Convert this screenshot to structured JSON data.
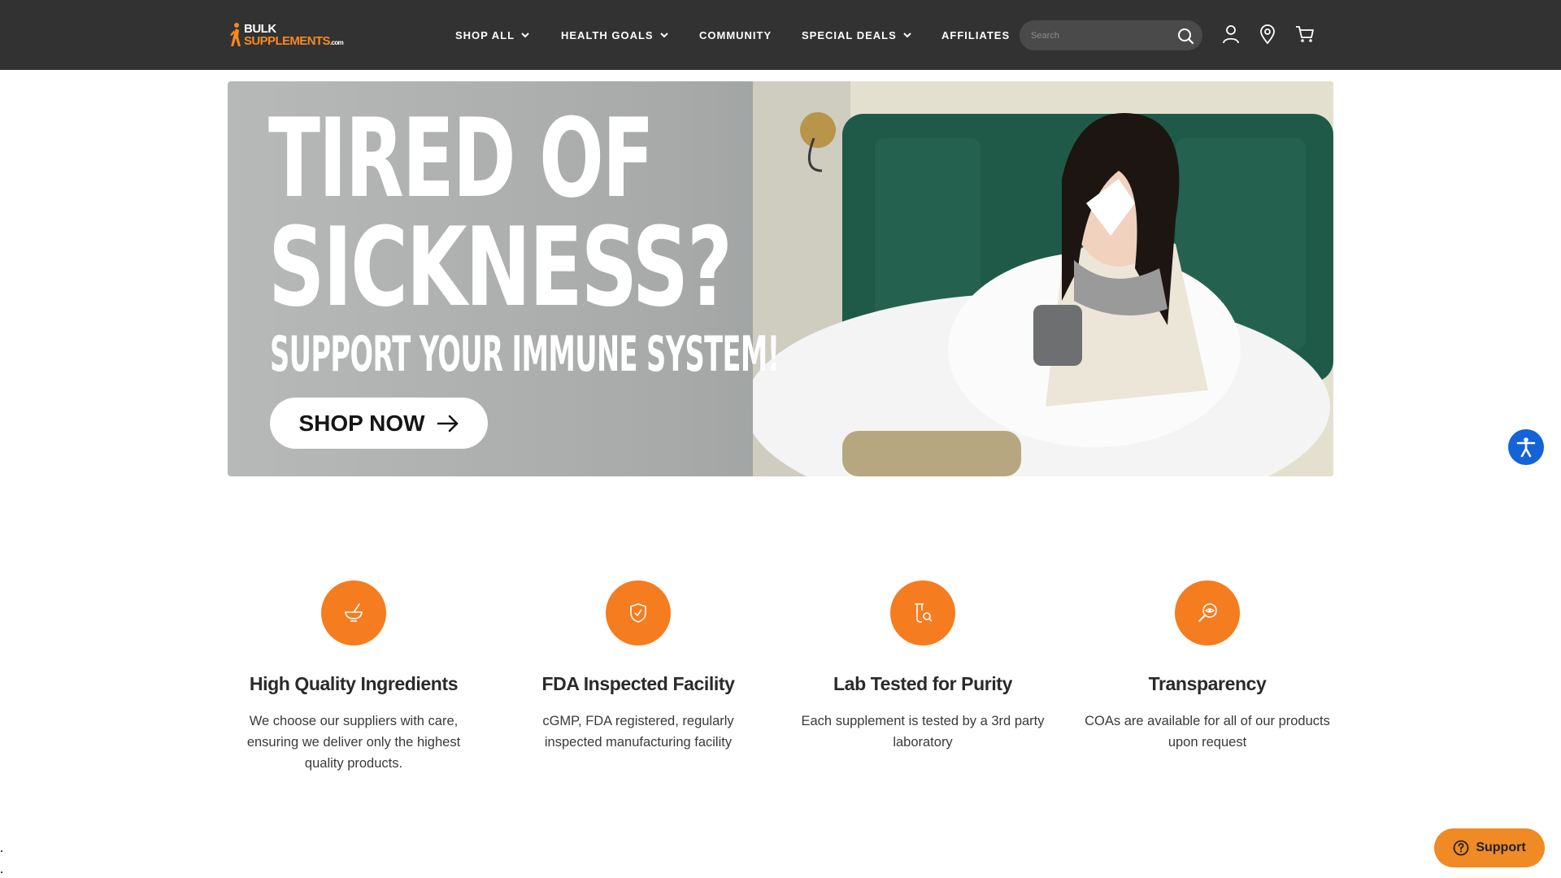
{
  "header": {
    "logo": {
      "line1": "BULK",
      "line2": "SUPPLEMENTS",
      "suffix": ".com"
    },
    "nav": [
      {
        "label": "SHOP ALL",
        "has_dropdown": true
      },
      {
        "label": "HEALTH GOALS",
        "has_dropdown": true
      },
      {
        "label": "COMMUNITY",
        "has_dropdown": false
      },
      {
        "label": "SPECIAL DEALS",
        "has_dropdown": true
      },
      {
        "label": "AFFILIATES",
        "has_dropdown": false
      }
    ],
    "search": {
      "placeholder": "Search",
      "value": ""
    },
    "icons": [
      "search-icon",
      "account-icon",
      "store-locator-icon",
      "cart-icon"
    ]
  },
  "hero": {
    "headline_line1": "TIRED OF",
    "headline_line2": "SICKNESS?",
    "subheadline": "SUPPORT YOUR IMMUNE SYSTEM!",
    "cta_label": "SHOP NOW"
  },
  "features": [
    {
      "icon": "mortar-pestle-icon",
      "title": "High Quality Ingredients",
      "description": "We choose our suppliers with care, ensuring we deliver only the highest quality products."
    },
    {
      "icon": "shield-check-icon",
      "title": "FDA Inspected Facility",
      "description": "cGMP, FDA registered, regularly inspected manufacturing facility"
    },
    {
      "icon": "lab-flask-search-icon",
      "title": "Lab Tested for Purity",
      "description": "Each supplement is tested by a 3rd party laboratory"
    },
    {
      "icon": "magnifier-eye-icon",
      "title": "Transparency",
      "description": "COAs are available for all of our products upon request"
    }
  ],
  "widgets": {
    "accessibility_icon": "accessibility-icon",
    "support_label": "Support"
  },
  "colors": {
    "header_bg": "#323232",
    "accent_orange": "#f57c1f",
    "accessibility_blue": "#1463d8"
  }
}
